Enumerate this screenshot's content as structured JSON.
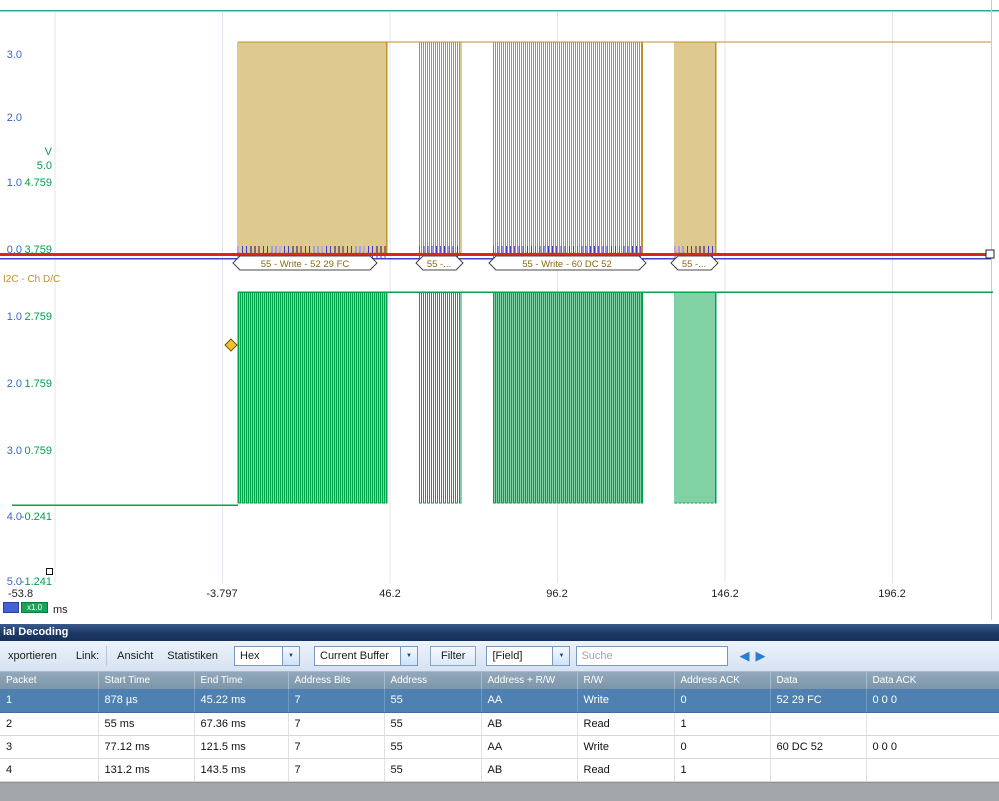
{
  "chart": {
    "unit_label": "V",
    "channel_label": "I2C - Ch D/C",
    "x_unit": "ms",
    "scale_badge": "x1.0",
    "y_axis_blue": [
      "3.0",
      "2.0",
      "1.0",
      "0.0",
      "1.0",
      "2.0",
      "3.0",
      "4.0",
      "5.0"
    ],
    "y_axis_green": [
      "5.0",
      "4.759",
      "3.759",
      "2.759",
      "1.759",
      "0.759",
      "-0.241",
      "-1.241"
    ],
    "x_tick_labels": [
      "-53.8",
      "-3.797",
      "46.2",
      "96.2",
      "146.2",
      "196.2"
    ],
    "bubbles": [
      "55 - Write - 52 29 FC",
      "55 -...",
      "55 - Write - 60 DC 52",
      "55 -..."
    ]
  },
  "chart_data": {
    "type": "line",
    "x_unit": "ms",
    "x_ticks": [
      -53.8,
      -3.797,
      46.2,
      96.2,
      146.2,
      196.2
    ],
    "y_axis_blue_range": [
      3.0,
      -5.0
    ],
    "y_axis_green_range": [
      5.0,
      -1.241
    ],
    "series": [
      {
        "name": "i2c-clock-gold",
        "color": "#BE9322",
        "high_v": 3.25,
        "low_v": 0.0,
        "bursts_ms": [
          [
            0.878,
            45.22
          ],
          [
            55,
            67.36
          ],
          [
            77.12,
            121.5
          ],
          [
            131.2,
            143.5
          ]
        ],
        "idle_before_v": 0.0,
        "idle_after_v": 3.25
      },
      {
        "name": "i2c-data-green",
        "color": "#00A44A",
        "high_v": 3.2,
        "low_v": 0.0,
        "bursts_ms": [
          [
            0.878,
            45.22
          ],
          [
            55,
            67.36
          ],
          [
            77.12,
            121.5
          ],
          [
            131.2,
            143.5
          ]
        ],
        "idle_before_v": 0.0,
        "idle_after_v": 3.2
      },
      {
        "name": "digital-blue",
        "color": "#3C45C8",
        "level_v": 0.0
      },
      {
        "name": "threshold-red",
        "color": "#D8271B",
        "level_v": 0.05
      }
    ]
  },
  "icons": {
    "dropdown_arrow": "▼",
    "nav_prev": "◀",
    "nav_next": "▶"
  },
  "panel": {
    "title": "ial Decoding",
    "toolbar": {
      "export_label": "xportieren",
      "link_label": "Link:",
      "view_label": "Ansicht",
      "stats_label": "Statistiken",
      "format_value": "Hex",
      "buffer_value": "Current Buffer",
      "filter_label": "Filter",
      "field_value": "[Field]",
      "search_placeholder": "Suche"
    },
    "table": {
      "columns": [
        "Packet",
        "Start Time",
        "End Time",
        "Address Bits",
        "Address",
        "Address + R/W",
        "R/W",
        "Address ACK",
        "Data",
        "Data ACK"
      ],
      "rows": [
        [
          "1",
          "878 µs",
          "45.22 ms",
          "7",
          "55",
          "AA",
          "Write",
          "0",
          "52 29 FC",
          "0 0 0"
        ],
        [
          "2",
          "55 ms",
          "67.36 ms",
          "7",
          "55",
          "AB",
          "Read",
          "1",
          "",
          ""
        ],
        [
          "3",
          "77.12 ms",
          "121.5 ms",
          "7",
          "55",
          "AA",
          "Write",
          "0",
          "60 DC 52",
          "0 0 0"
        ],
        [
          "4",
          "131.2 ms",
          "143.5 ms",
          "7",
          "55",
          "AB",
          "Read",
          "1",
          "",
          ""
        ]
      ],
      "selected_row": 0
    }
  }
}
